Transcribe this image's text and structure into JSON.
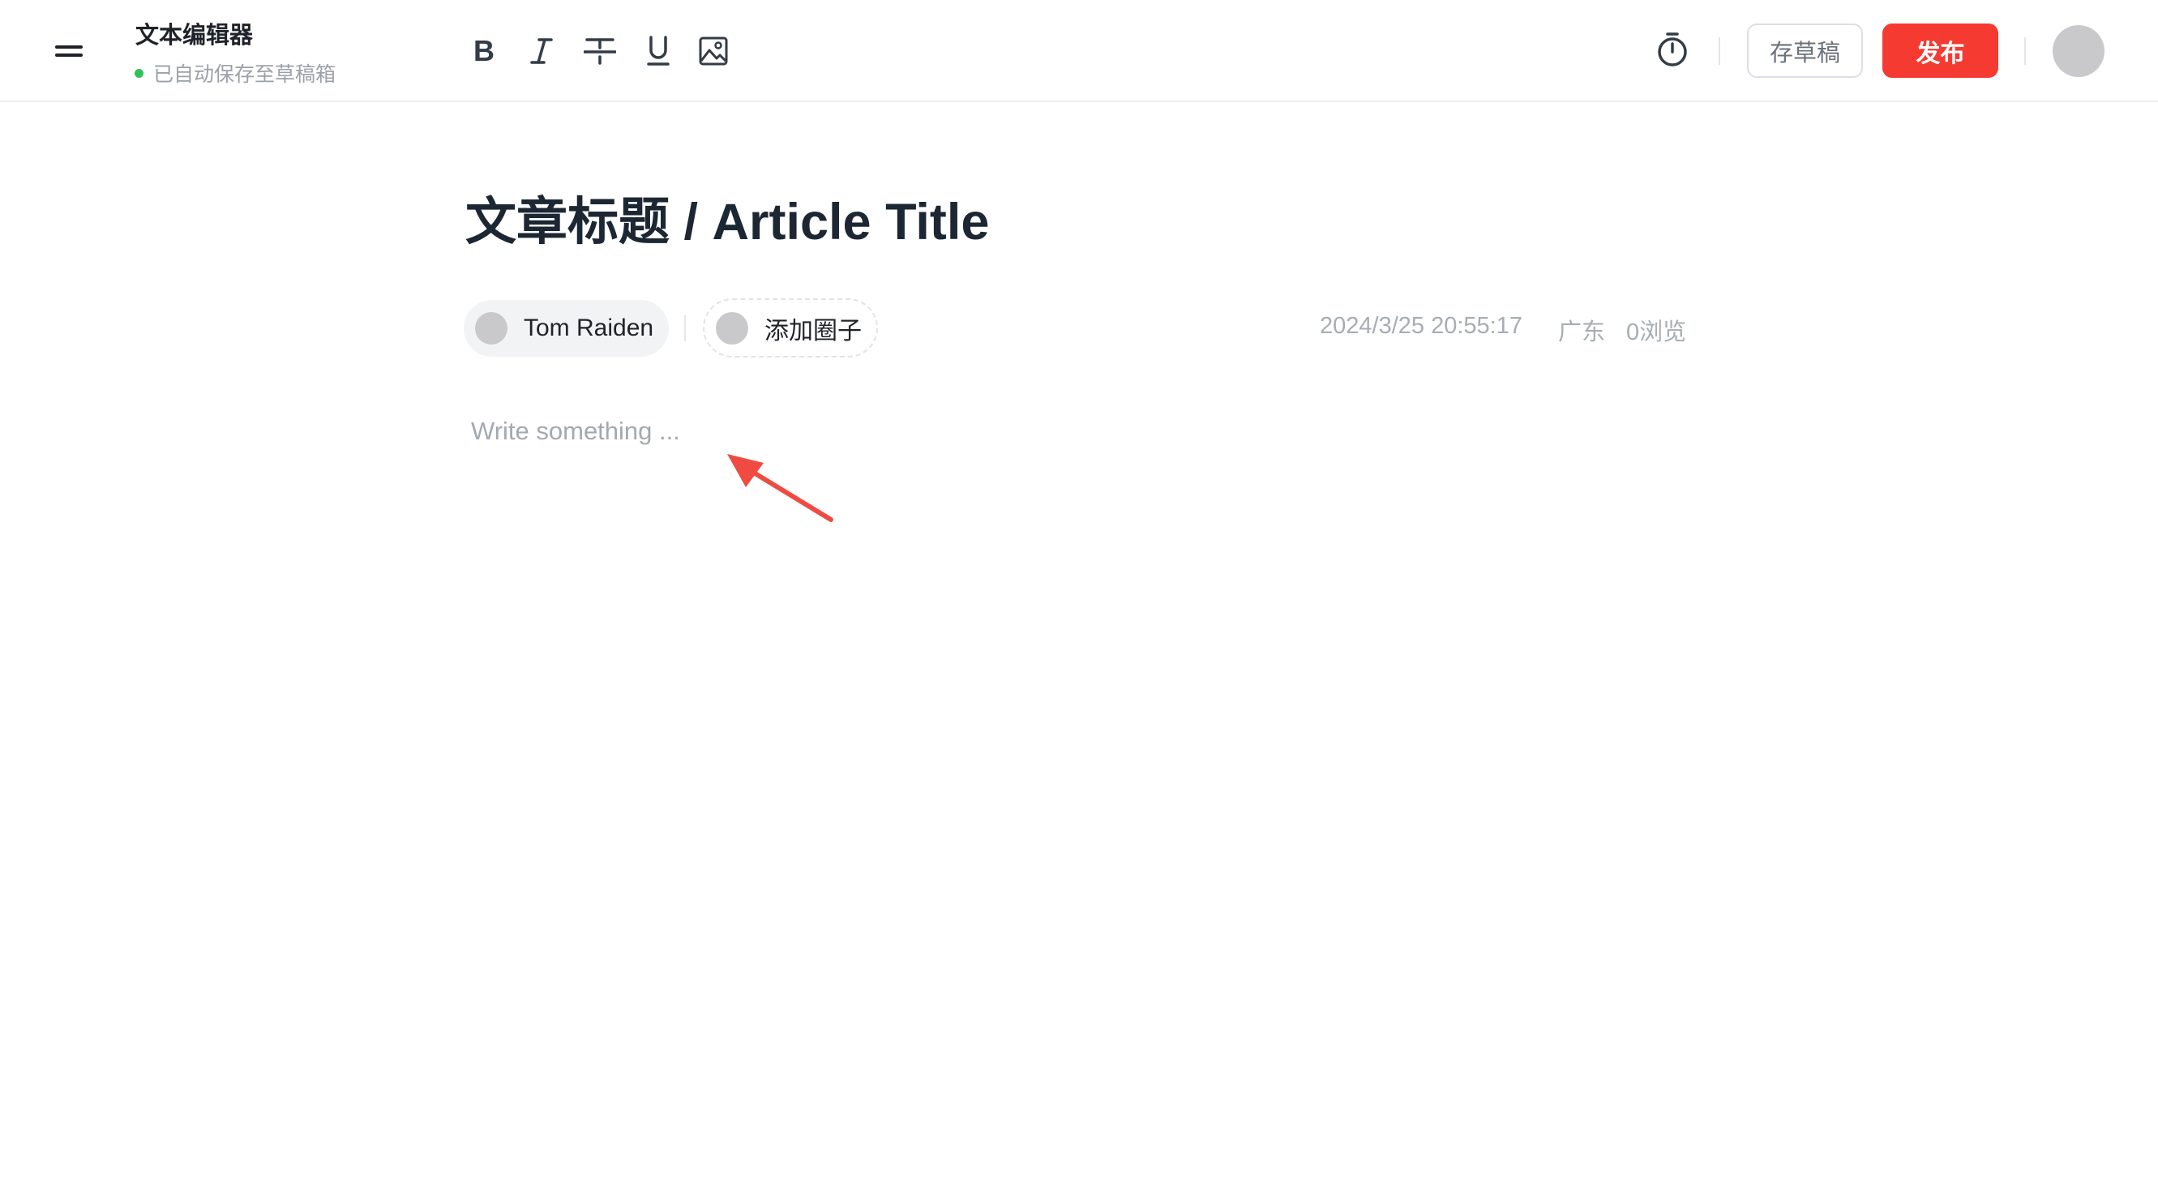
{
  "header": {
    "app_title": "文本编辑器",
    "save_status": "已自动保存至草稿箱",
    "status_color": "#2fc25b",
    "toolbar": [
      {
        "name": "bold",
        "icon": "bold-icon"
      },
      {
        "name": "italic",
        "icon": "italic-icon"
      },
      {
        "name": "strikethrough",
        "icon": "strikethrough-icon"
      },
      {
        "name": "underline",
        "icon": "underline-icon"
      },
      {
        "name": "image",
        "icon": "image-icon"
      }
    ],
    "timer_icon": "timer-icon",
    "draft_label": "存草稿",
    "publish_label": "发布",
    "publish_color": "#f53a31"
  },
  "article": {
    "title": "文章标题 / Article Title",
    "author": "Tom Raiden",
    "add_circle_label": "添加圈子",
    "datetime": "2024/3/25 20:55:17",
    "location": "广东",
    "views": "0浏览",
    "editor_placeholder": "Write something ...",
    "annotation_color": "#ef4b42"
  }
}
